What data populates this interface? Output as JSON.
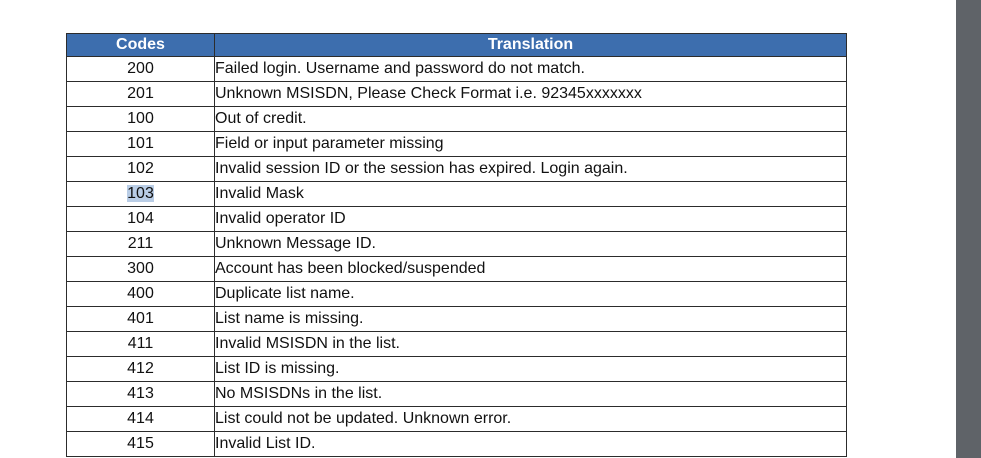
{
  "table": {
    "headers": {
      "code": "Codes",
      "translation": "Translation"
    },
    "rows": [
      {
        "code": "200",
        "translation": "Failed login. Username and password do not match."
      },
      {
        "code": "201",
        "translation": "Unknown MSISDN, Please Check Format i.e. 92345xxxxxxx"
      },
      {
        "code": "100",
        "translation": "Out of credit."
      },
      {
        "code": "101",
        "translation": "Field or input parameter missing"
      },
      {
        "code": "102",
        "translation": "Invalid session ID or the session has expired. Login again."
      },
      {
        "code": "103",
        "translation": "Invalid Mask",
        "selected": true
      },
      {
        "code": "104",
        "translation": "Invalid operator ID"
      },
      {
        "code": "211",
        "translation": "Unknown Message ID."
      },
      {
        "code": "300",
        "translation": "Account has been blocked/suspended"
      },
      {
        "code": "400",
        "translation": "Duplicate list name."
      },
      {
        "code": "401",
        "translation": "List name is missing."
      },
      {
        "code": "411",
        "translation": "Invalid MSISDN in the list."
      },
      {
        "code": "412",
        "translation": "List ID is missing."
      },
      {
        "code": "413",
        "translation": "No MSISDNs in the list."
      },
      {
        "code": "414",
        "translation": "List could not be updated. Unknown error."
      },
      {
        "code": "415",
        "translation": "Invalid List ID."
      }
    ]
  },
  "colors": {
    "header_bg": "#3d6eae",
    "header_text": "#ffffff",
    "selection": "#b9cde6",
    "side_panel": "#5f6368"
  }
}
